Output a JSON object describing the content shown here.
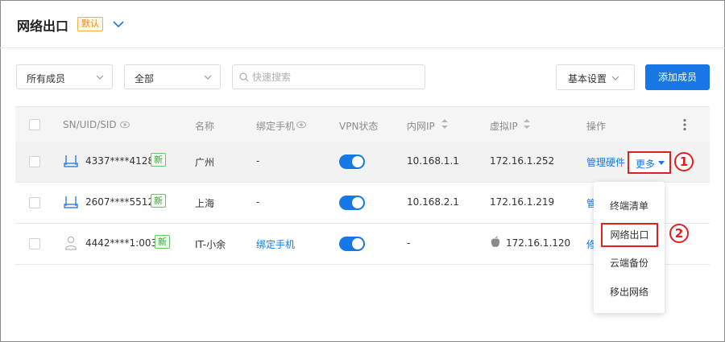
{
  "header": {
    "title": "网络出口",
    "badge": "默认"
  },
  "toolbar": {
    "member_filter": "所有成员",
    "status_filter": "全部",
    "search_placeholder": "快速搜索",
    "settings_label": "基本设置",
    "add_label": "添加成员"
  },
  "table": {
    "columns": {
      "sn": "SN/UID/SID",
      "name": "名称",
      "phone": "绑定手机",
      "vpn": "VPN状态",
      "inner_ip": "内网IP",
      "virtual_ip": "虚拟IP",
      "action": "操作"
    },
    "rows": [
      {
        "device_icon": "router-icon",
        "sn": "4337****4128",
        "badge": "新",
        "name": "广州",
        "phone": "-",
        "vpn_on": true,
        "inner_ip": "10.168.1.1",
        "virtual_ip": "172.16.1.252",
        "action": "管理硬件",
        "more": "更多"
      },
      {
        "device_icon": "router-icon",
        "sn": "2607****5512",
        "badge": "新",
        "name": "上海",
        "phone": "-",
        "vpn_on": true,
        "inner_ip": "10.168.2.1",
        "virtual_ip": "172.16.1.219",
        "action": "管"
      },
      {
        "device_icon": "user-icon",
        "sn": "4442****1:003",
        "badge": "新",
        "name": "IT-小余",
        "phone": "绑定手机",
        "vpn_on": true,
        "inner_ip": "-",
        "virtual_ip": "172.16.1.120",
        "virtual_ip_icon": "apple-icon",
        "action": "修"
      }
    ]
  },
  "menu": {
    "items": [
      "终端清单",
      "网络出口",
      "云端备份",
      "移出网络"
    ]
  },
  "annotations": {
    "step1": "1",
    "step2": "2"
  },
  "colors": {
    "accent": "#1677e5",
    "highlight": "#e02020",
    "badge_orange": "#f08a00",
    "badge_green": "#3aa53a"
  }
}
